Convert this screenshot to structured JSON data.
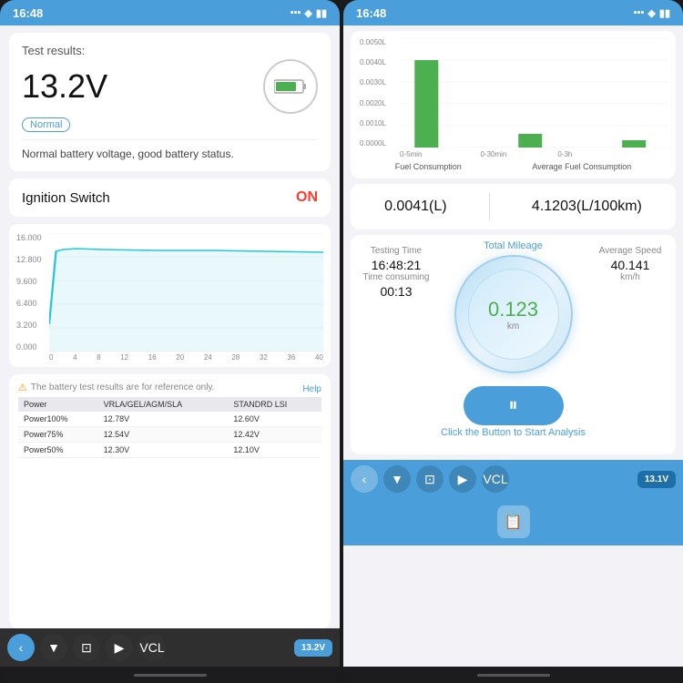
{
  "left": {
    "status": {
      "time": "16:48",
      "icons": "●●● ▲ ▮▮"
    },
    "battery_test": {
      "label": "Test results:",
      "voltage": "13.2V",
      "badge": "Normal",
      "description": "Normal battery voltage, good battery status."
    },
    "ignition": {
      "label": "Ignition Switch",
      "status": "ON"
    },
    "chart": {
      "y_labels": [
        "16.000",
        "12.800",
        "9.600",
        "6.400",
        "3.200",
        "0.000"
      ],
      "x_labels": [
        "0",
        "4",
        "8",
        "12",
        "16",
        "20",
        "24",
        "28",
        "32",
        "36",
        "40"
      ]
    },
    "warning": "The battery test results are for reference only.",
    "help": "Help",
    "table": {
      "headers": [
        "Power",
        "VRLA/GEL/AGM/SLA",
        "STANDRD LSI"
      ],
      "rows": [
        [
          "Power100%",
          "12.78V",
          "12.60V"
        ],
        [
          "Power75%",
          "12.54V",
          "12.42V"
        ],
        [
          "Power50%",
          "12.30V",
          "12.10V"
        ]
      ]
    },
    "toolbar": {
      "back": "‹",
      "filter": "▼",
      "crop": "⊡",
      "play": "▶",
      "vcl": "VCL",
      "voltage": "13.2V"
    }
  },
  "right": {
    "status": {
      "time": "16:48",
      "icons": "●●● ▲ ▮▮"
    },
    "fuel_chart": {
      "y_labels": [
        "0.0050L",
        "0.0040L",
        "0.0030L",
        "0.0020L",
        "0.0010L",
        "0.0000L"
      ],
      "x_labels": [
        "0-5min",
        "0-30min",
        "0-3h"
      ],
      "bars": [
        {
          "height_pct": 80
        },
        {
          "height_pct": 12
        },
        {
          "height_pct": 6
        }
      ],
      "legend": {
        "left": "Fuel Consumption",
        "right": "Average Fuel Consumption"
      }
    },
    "fuel_values": {
      "left": "0.0041(L)",
      "right": "4.1203(L/100km)"
    },
    "gauge": {
      "title": "Total Mileage",
      "mileage": "0.123",
      "unit": "km",
      "testing_time_label": "Testing Time",
      "testing_time_value": "16:48:21",
      "time_consuming_label": "Time consuming",
      "time_consuming_value": "00:13",
      "avg_speed_label": "Average Speed",
      "avg_speed_value": "40.141",
      "avg_speed_unit": "km/h"
    },
    "pause_btn": "⏸",
    "analysis_label": "Click the Button to Start Analysis",
    "toolbar": {
      "back": "‹",
      "filter": "▼",
      "crop": "⊡",
      "play": "▶",
      "vcl": "VCL",
      "voltage": "13.1V"
    },
    "action_icon": "📋"
  }
}
